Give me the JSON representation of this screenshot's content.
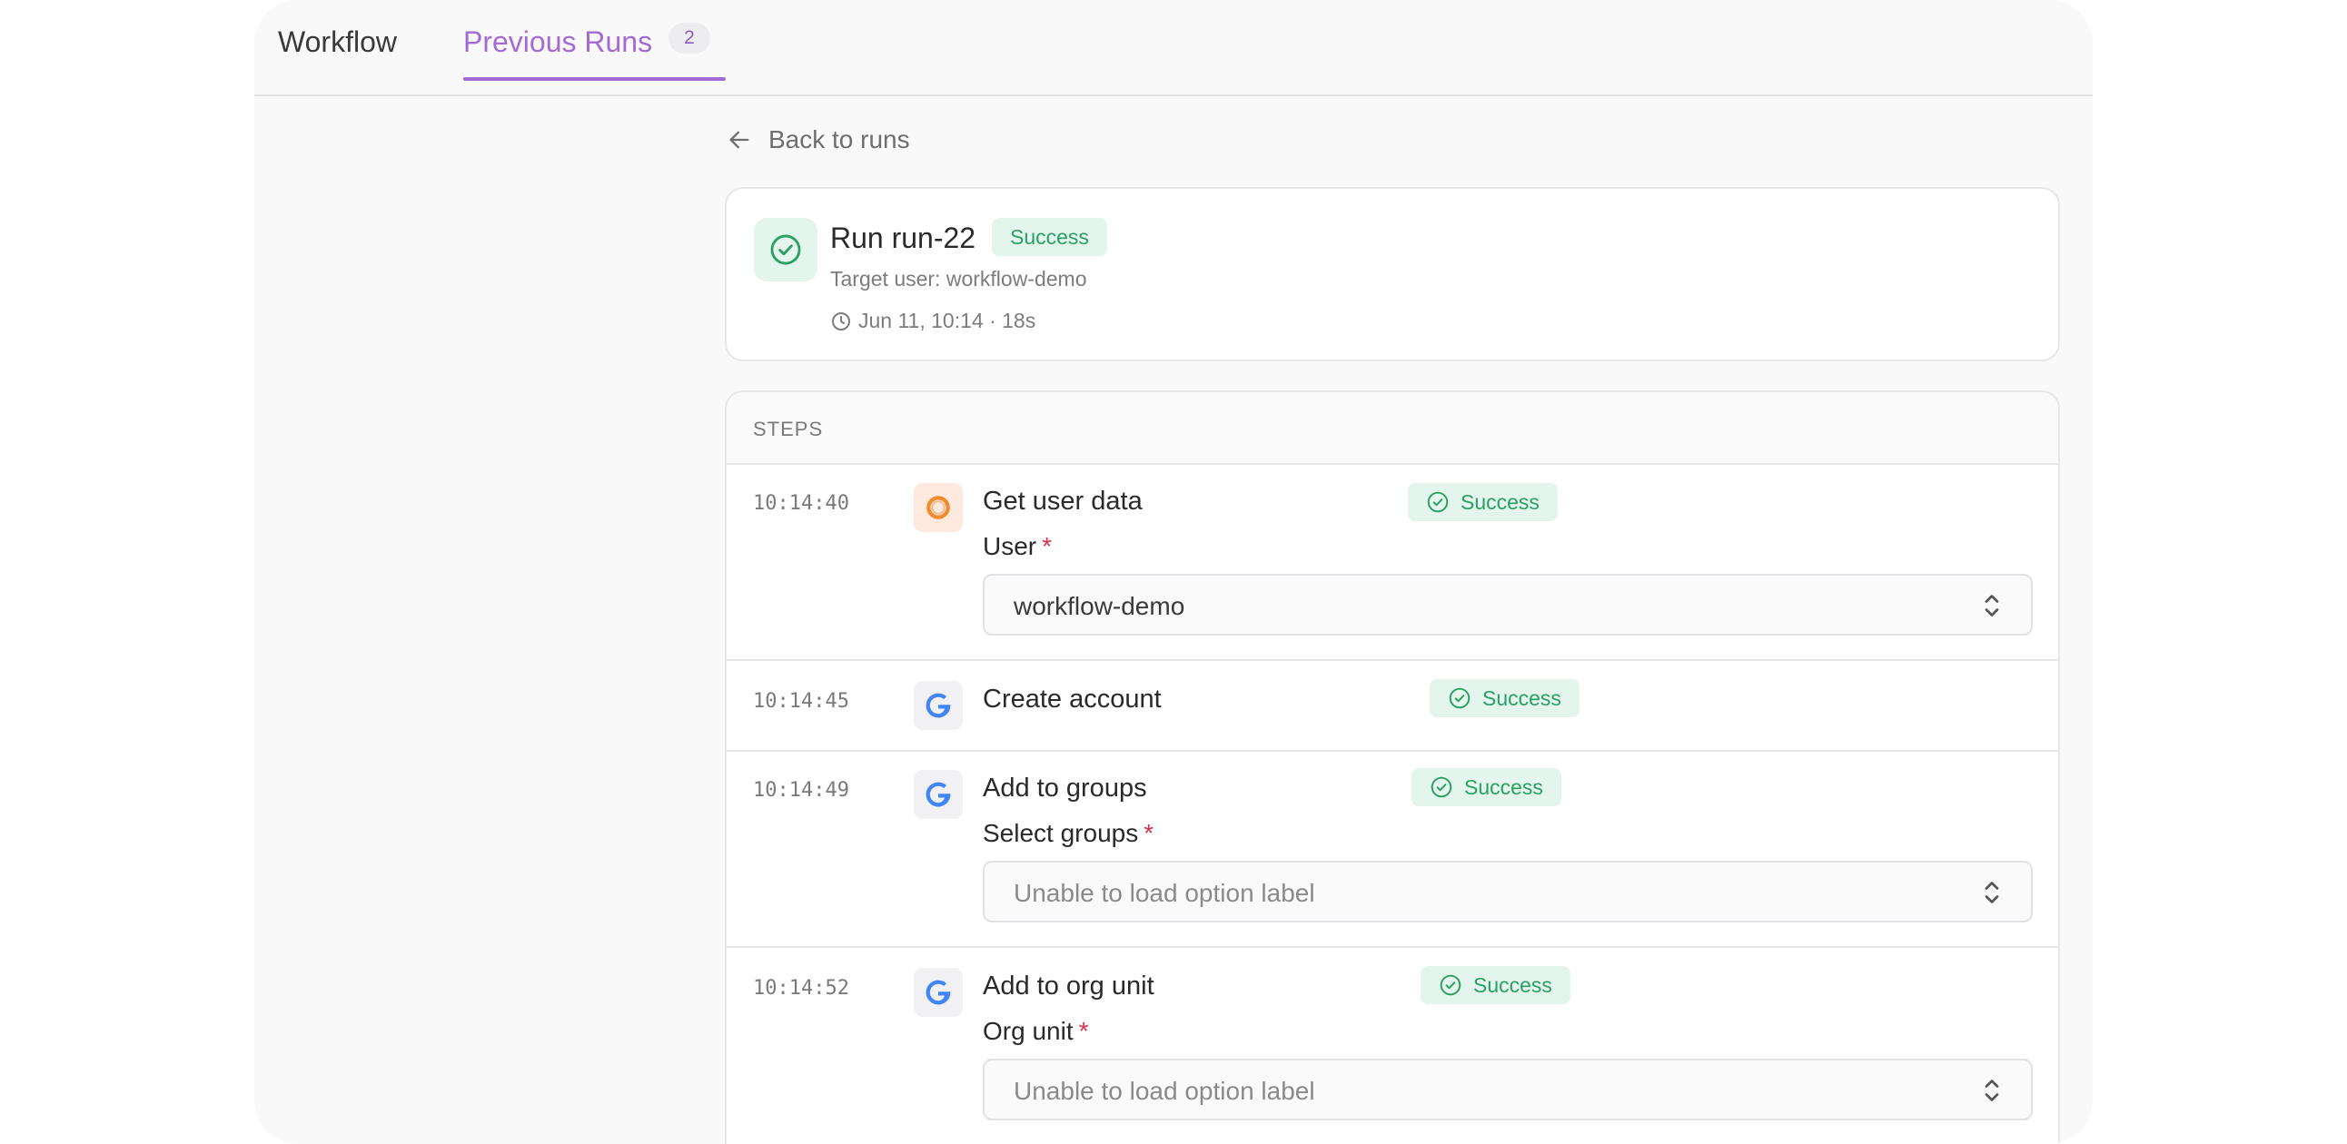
{
  "tabs": {
    "workflow": "Workflow",
    "previous_runs": "Previous Runs",
    "previous_runs_count": "2"
  },
  "back_link": "Back to runs",
  "run": {
    "title": "Run run-22",
    "status": "Success",
    "target_user": "Target user: workflow-demo",
    "timing": "Jun 11, 10:14 · 18s"
  },
  "steps_header": "STEPS",
  "steps": [
    {
      "time": "10:14:40",
      "icon": "hr-provider-icon",
      "name": "Get user data",
      "status": "Success",
      "field_label": "User",
      "field_value": "workflow-demo"
    },
    {
      "time": "10:14:45",
      "icon": "google-icon",
      "name": "Create account",
      "status": "Success"
    },
    {
      "time": "10:14:49",
      "icon": "google-icon",
      "name": "Add to groups",
      "status": "Success",
      "field_label": "Select groups",
      "field_value": "Unable to load option label"
    },
    {
      "time": "10:14:52",
      "icon": "google-icon",
      "name": "Add to org unit",
      "status": "Success",
      "field_label": "Org unit",
      "field_value": "Unable to load option label"
    }
  ],
  "required_marker": "*",
  "colors": {
    "accent": "#a56ad6",
    "success_bg": "#e3f5ec",
    "success_text": "#2aa064",
    "required": "#d9304c",
    "google_blue": "#4285f4",
    "hr_orange": "#f28a2e"
  }
}
